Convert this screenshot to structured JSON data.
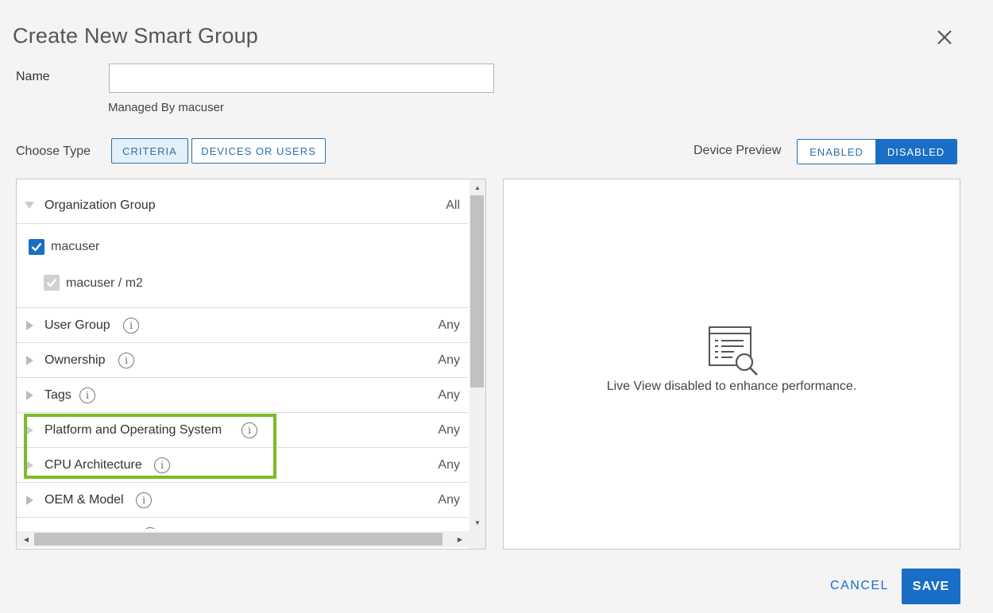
{
  "dialog": {
    "title": "Create New Smart Group",
    "close_icon": "close-icon"
  },
  "name_field": {
    "label": "Name",
    "value": "",
    "placeholder": "",
    "managed_by": "Managed By macuser"
  },
  "choose_type": {
    "label": "Choose Type",
    "options": [
      "CRITERIA",
      "DEVICES OR USERS"
    ],
    "selected": "CRITERIA"
  },
  "device_preview": {
    "label": "Device Preview",
    "options": [
      "ENABLED",
      "DISABLED"
    ],
    "selected": "DISABLED"
  },
  "criteria": {
    "organization_group": {
      "label": "Organization Group",
      "value": "All",
      "items": [
        {
          "label": "macuser",
          "checked": true,
          "disabled": false
        },
        {
          "label": "macuser / m2",
          "checked": true,
          "disabled": true
        }
      ]
    },
    "rows": [
      {
        "label": "User Group",
        "value": "Any"
      },
      {
        "label": "Ownership",
        "value": "Any"
      },
      {
        "label": "Tags",
        "value": "Any"
      },
      {
        "label": "Platform and Operating System",
        "value": "Any"
      },
      {
        "label": "CPU Architecture",
        "value": "Any"
      },
      {
        "label": "OEM & Model",
        "value": "Any"
      }
    ],
    "info_glyph": "i"
  },
  "preview": {
    "icon": "search-list-icon",
    "message": "Live View disabled to enhance performance."
  },
  "footer": {
    "cancel_label": "CANCEL",
    "save_label": "SAVE"
  },
  "colors": {
    "accent": "#1a6ec6",
    "highlight": "#7cbb2b",
    "background": "#f4f4f4"
  }
}
